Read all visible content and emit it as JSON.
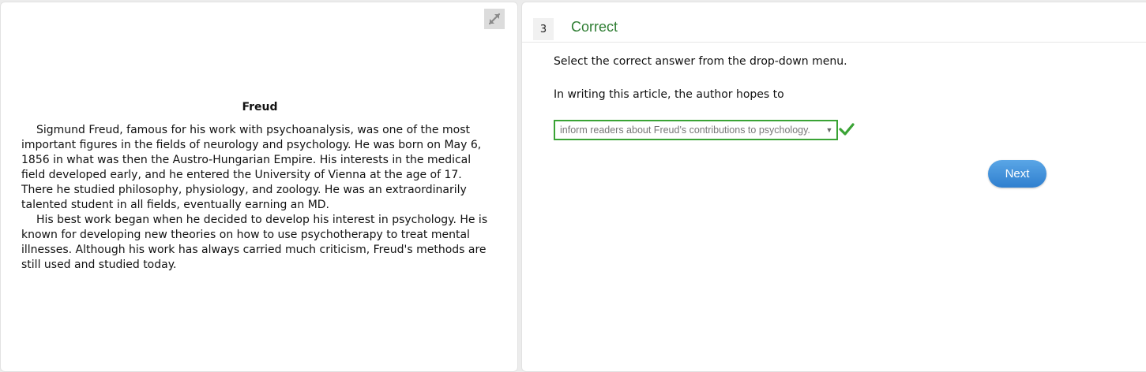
{
  "passage": {
    "title": "Freud",
    "paragraphs": [
      "Sigmund Freud, famous for his work with psychoanalysis, was one of the most important figures in the fields of neurology and psychology. He was born on May 6, 1856 in what was then the Austro-Hungarian Empire. His interests in the medical field developed early, and he entered the University of Vienna at the age of 17. There he studied philosophy, physiology, and zoology. He was an extraordinarily talented student in all fields, eventually earning an MD.",
      "His best work began when he decided to develop his interest in psychology. He is known for developing new theories on how to use psychotherapy to treat mental illnesses. Although his work has always carried much criticism, Freud's methods are still used and studied today."
    ],
    "expand_icon": "expand-arrows-icon"
  },
  "question": {
    "number": "3",
    "status": "Correct",
    "instruction": "Select the correct answer from the drop-down menu.",
    "prompt": "In writing this article, the author hopes to",
    "selected_answer": "inform readers about Freud's contributions to psychology.",
    "dropdown_icon": "triangle-down-icon",
    "result_icon": "check-icon",
    "next_label": "Next"
  },
  "colors": {
    "correct_green": "#2e7d32",
    "dropdown_border": "#3aa335",
    "check_green": "#3aa335",
    "next_button": "#3d8fdc"
  }
}
